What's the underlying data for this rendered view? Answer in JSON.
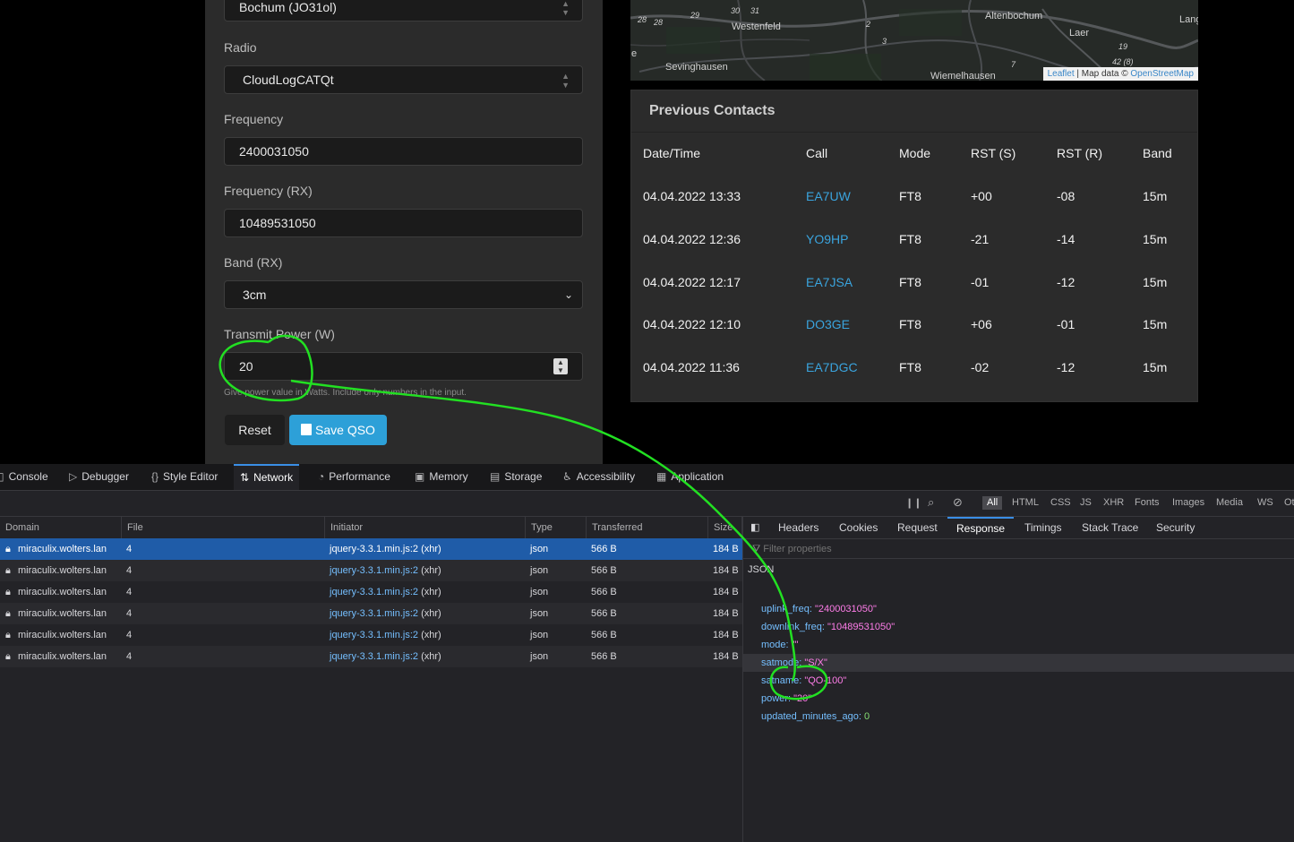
{
  "form": {
    "station_select": "Bochum (JO31ol)",
    "radio_label": "Radio",
    "radio_value": "CloudLogCATQt",
    "freq_label": "Frequency",
    "freq_value": "2400031050",
    "freq_rx_label": "Frequency (RX)",
    "freq_rx_value": "10489531050",
    "band_rx_label": "Band (RX)",
    "band_rx_value": "3cm",
    "power_label": "Transmit Power (W)",
    "power_value": "20",
    "power_help": "Give power value in Watts. Include only numbers in the input.",
    "reset_label": "Reset",
    "save_label": "Save QSO"
  },
  "map": {
    "places": [
      "Westenfeld",
      "Altenbochum",
      "Laer",
      "Sevinghausen",
      "Wiemelhausen",
      "Lang",
      "e"
    ],
    "road_numbers": [
      "28",
      "28",
      "29",
      "30",
      "31",
      "2",
      "3",
      "19",
      "42 (8)",
      "7"
    ],
    "attribution_leaflet": "Leaflet",
    "attribution_mid": " | Map data © ",
    "attribution_osm": "OpenStreetMap"
  },
  "contacts": {
    "title": "Previous Contacts",
    "headers": [
      "Date/Time",
      "Call",
      "Mode",
      "RST (S)",
      "RST (R)",
      "Band"
    ],
    "rows": [
      [
        "04.04.2022 13:33",
        "EA7UW",
        "FT8",
        "+00",
        "-08",
        "15m"
      ],
      [
        "04.04.2022 12:36",
        "YO9HP",
        "FT8",
        "-21",
        "-14",
        "15m"
      ],
      [
        "04.04.2022 12:17",
        "EA7JSA",
        "FT8",
        "-01",
        "-12",
        "15m"
      ],
      [
        "04.04.2022 12:10",
        "DO3GE",
        "FT8",
        "+06",
        "-01",
        "15m"
      ],
      [
        "04.04.2022 11:36",
        "EA7DGC",
        "FT8",
        "-02",
        "-12",
        "15m"
      ]
    ]
  },
  "devtools": {
    "tabs": [
      "Console",
      "Debugger",
      "Style Editor",
      "Network",
      "Performance",
      "Memory",
      "Storage",
      "Accessibility",
      "Application"
    ],
    "active_tab": "Network",
    "filters": [
      "All",
      "HTML",
      "CSS",
      "JS",
      "XHR",
      "Fonts",
      "Images",
      "Media",
      "WS",
      "Ot"
    ],
    "columns": [
      "Domain",
      "File",
      "Initiator",
      "Type",
      "Transferred",
      "Size"
    ],
    "requests": [
      {
        "domain": "miraculix.wolters.lan",
        "file": "4",
        "initiator": "jquery-3.3.1.min.js:2",
        "initiator_kind": "(xhr)",
        "type": "json",
        "transferred": "566 B",
        "size": "184 B"
      },
      {
        "domain": "miraculix.wolters.lan",
        "file": "4",
        "initiator": "jquery-3.3.1.min.js:2",
        "initiator_kind": "(xhr)",
        "type": "json",
        "transferred": "566 B",
        "size": "184 B"
      },
      {
        "domain": "miraculix.wolters.lan",
        "file": "4",
        "initiator": "jquery-3.3.1.min.js:2",
        "initiator_kind": "(xhr)",
        "type": "json",
        "transferred": "566 B",
        "size": "184 B"
      },
      {
        "domain": "miraculix.wolters.lan",
        "file": "4",
        "initiator": "jquery-3.3.1.min.js:2",
        "initiator_kind": "(xhr)",
        "type": "json",
        "transferred": "566 B",
        "size": "184 B"
      },
      {
        "domain": "miraculix.wolters.lan",
        "file": "4",
        "initiator": "jquery-3.3.1.min.js:2",
        "initiator_kind": "(xhr)",
        "type": "json",
        "transferred": "566 B",
        "size": "184 B"
      },
      {
        "domain": "miraculix.wolters.lan",
        "file": "4",
        "initiator": "jquery-3.3.1.min.js:2",
        "initiator_kind": "(xhr)",
        "type": "json",
        "transferred": "566 B",
        "size": "184 B"
      }
    ],
    "selected_request": 0,
    "side_tabs": [
      "Headers",
      "Cookies",
      "Request",
      "Response",
      "Timings",
      "Stack Trace",
      "Security"
    ],
    "active_side_tab": "Response",
    "filter_placeholder": "Filter properties",
    "json_header": "JSON",
    "json": [
      {
        "key": "uplink_freq:",
        "value": "\"2400031050\"",
        "kind": "string"
      },
      {
        "key": "downlink_freq:",
        "value": "\"10489531050\"",
        "kind": "string"
      },
      {
        "key": "mode:",
        "value": "\"\"",
        "kind": "string"
      },
      {
        "key": "satmode:",
        "value": "\"S/X\"",
        "kind": "string"
      },
      {
        "key": "satname:",
        "value": "\"QO-100\"",
        "kind": "string"
      },
      {
        "key": "power:",
        "value": "\"20\"",
        "kind": "string"
      },
      {
        "key": "updated_minutes_ago:",
        "value": "0",
        "kind": "number"
      }
    ],
    "selected_json_row": 3
  },
  "colors": {
    "accent": "#2da0d8",
    "link": "#3aa4de",
    "annotation": "#22e022",
    "devtools_bg": "#232327",
    "selected_row": "#1f5ca8"
  }
}
